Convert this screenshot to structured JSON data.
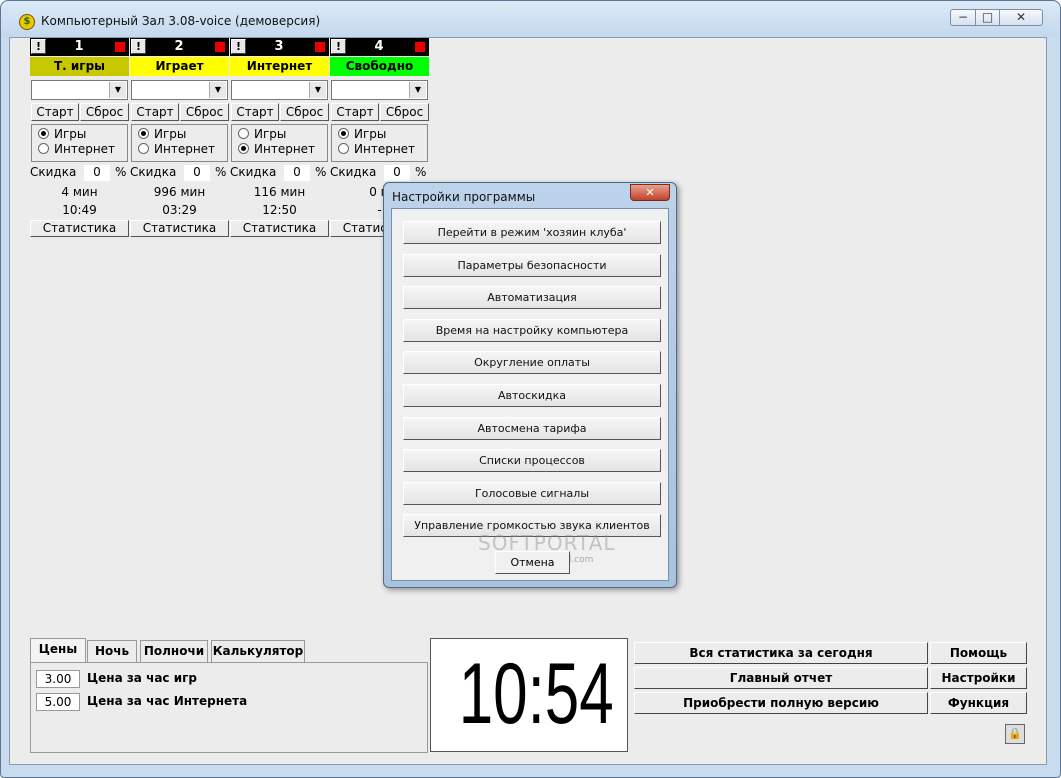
{
  "window": {
    "title": "Компьютерный Зал 3.08-voice (демоверсия)",
    "minimize": "−",
    "maximize": "□",
    "close": "✕",
    "app_icon": "$"
  },
  "workstations": [
    {
      "num": "1",
      "status": "Т. игры",
      "status_color": "#c8c800",
      "start": "Старт",
      "reset": "Сброс",
      "radio_games": "Игры",
      "radio_internet": "Интернет",
      "selected": "games",
      "discount_label": "Скидка",
      "discount": "0",
      "pct": "%",
      "minutes": "4 мин",
      "time": "10:49",
      "stats": "Статистика"
    },
    {
      "num": "2",
      "status": "Играет",
      "status_color": "#ffff00",
      "start": "Старт",
      "reset": "Сброс",
      "radio_games": "Игры",
      "radio_internet": "Интернет",
      "selected": "games",
      "discount_label": "Скидка",
      "discount": "0",
      "pct": "%",
      "minutes": "996 мин",
      "time": "03:29",
      "stats": "Статистика"
    },
    {
      "num": "3",
      "status": "Интернет",
      "status_color": "#ffff00",
      "start": "Старт",
      "reset": "Сброс",
      "radio_games": "Игры",
      "radio_internet": "Интернет",
      "selected": "internet",
      "discount_label": "Скидка",
      "discount": "0",
      "pct": "%",
      "minutes": "116 мин",
      "time": "12:50",
      "stats": "Статистика"
    },
    {
      "num": "4",
      "status": "Свободно",
      "status_color": "#00ff00",
      "start": "Старт",
      "reset": "Сброс",
      "radio_games": "Игры",
      "radio_internet": "Интернет",
      "selected": "games",
      "discount_label": "Скидка",
      "discount": "0",
      "pct": "%",
      "minutes": "0 м",
      "time": "-",
      "stats": "Статистика"
    }
  ],
  "tabs": [
    "Цены",
    "Ночь",
    "Полночи",
    "Калькулятор"
  ],
  "prices": [
    {
      "value": "3.00",
      "label": "Цена за час игр"
    },
    {
      "value": "5.00",
      "label": "Цена за час Интернета"
    }
  ],
  "clock": "10:54",
  "buttons": {
    "stats_today": "Вся статистика за сегодня",
    "help": "Помощь",
    "main_report": "Главный отчет",
    "settings": "Настройки",
    "buy": "Приобрести полную версию",
    "function": "Функция"
  },
  "dialog": {
    "title": "Настройки программы",
    "close": "✕",
    "items": [
      "Перейти в режим 'хозяин клуба'",
      "Параметры безопасности",
      "Автоматизация",
      "Время на настройку компьютера",
      "Округление оплаты",
      "Автоскидка",
      "Автосмена тарифа",
      "Списки процессов",
      "Голосовые сигналы",
      "Управление громкостью звука клиентов"
    ],
    "cancel": "Отмена",
    "watermark": "SOFTPORTAL",
    "watermark_url": "www.softportal.com"
  }
}
